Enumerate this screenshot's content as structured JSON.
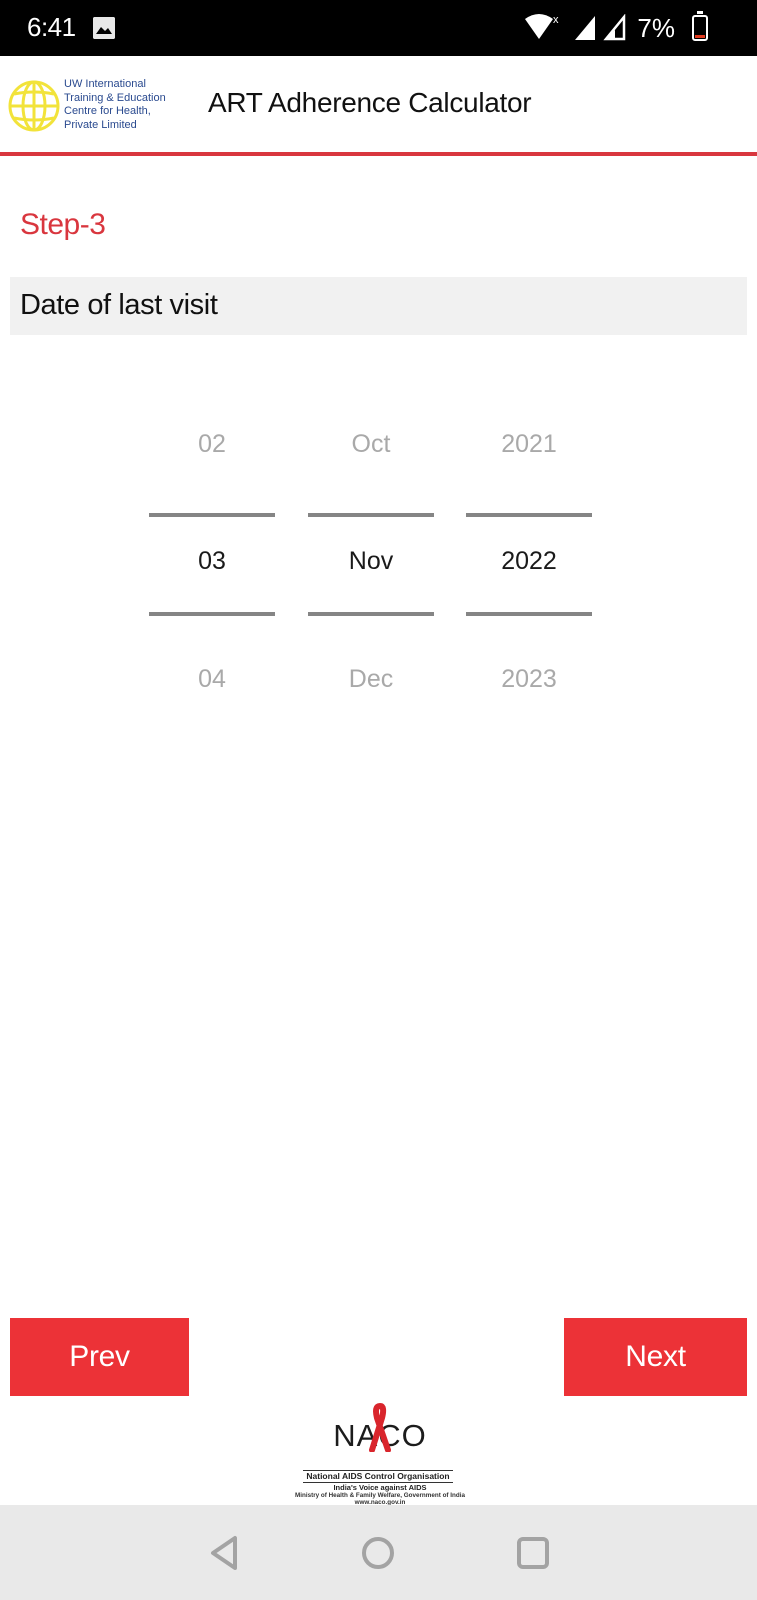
{
  "status_bar": {
    "time": "6:41",
    "battery_percent": "7%",
    "icons": [
      "image-notification-icon",
      "wifi-icon",
      "signal-icon",
      "signal-empty-icon",
      "battery-icon"
    ]
  },
  "header": {
    "org_logo_icon": "globe-logo-icon",
    "org_name_lines": [
      "UW International",
      "Training & Education",
      "Centre for Health,",
      "Private Limited"
    ],
    "title": "ART Adherence Calculator",
    "accent_color": "#d9363e"
  },
  "step": {
    "label": "Step-3",
    "field_label": "Date of last visit"
  },
  "date_picker": {
    "day": {
      "prev": "02",
      "selected": "03",
      "next": "04"
    },
    "month": {
      "prev": "Oct",
      "selected": "Nov",
      "next": "Dec"
    },
    "year": {
      "prev": "2021",
      "selected": "2022",
      "next": "2023"
    }
  },
  "buttons": {
    "prev_label": "Prev",
    "next_label": "Next",
    "color": "#ec3237"
  },
  "footer": {
    "logo_text": "NACO",
    "org_name": "National AIDS Control Organisation",
    "tagline": "India's Voice against AIDS",
    "ministry": "Ministry of Health & Family Welfare, Government of India",
    "url": "www.naco.gov.in"
  },
  "nav_bar": {
    "icons": [
      "back-icon",
      "home-icon",
      "recents-icon"
    ]
  }
}
